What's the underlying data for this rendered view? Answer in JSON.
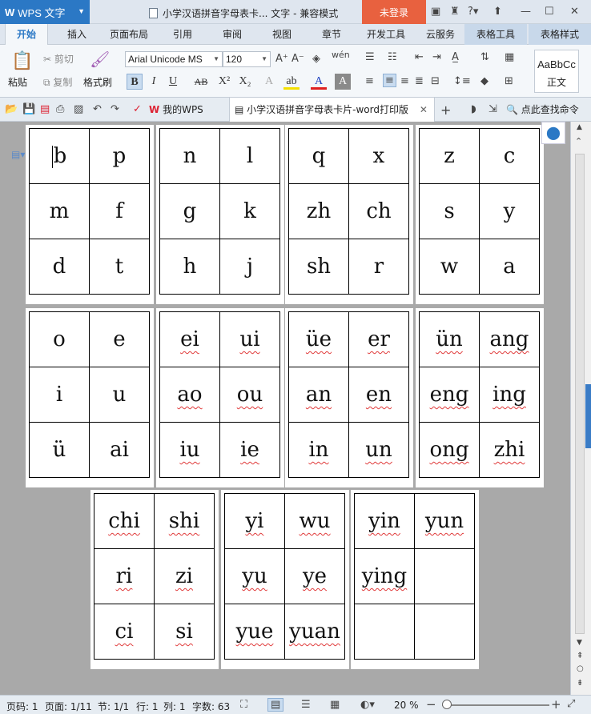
{
  "titlebar": {
    "app_name": "WPS 文字",
    "document_title": "小学汉语拼音字母表卡... 文字 - 兼容模式",
    "login_label": "未登录"
  },
  "ribbon_tabs": [
    "开始",
    "插入",
    "页面布局",
    "引用",
    "审阅",
    "视图",
    "章节",
    "开发工具",
    "云服务",
    "表格工具",
    "表格样式"
  ],
  "ribbon": {
    "paste_label": "粘贴",
    "cut_label": "剪切",
    "copy_label": "复制",
    "format_painter_label": "格式刷",
    "font_name": "Arial Unicode MS",
    "font_size": "120",
    "style_preview": "AaBbCc",
    "style_name": "正文"
  },
  "doc_tabs": {
    "my_wps": "我的WPS",
    "document": "小学汉语拼音字母表卡片-word打印版",
    "search_command": "点此查找命令"
  },
  "cards": [
    [
      [
        "b",
        "p"
      ],
      [
        "m",
        "f"
      ],
      [
        "d",
        "t"
      ]
    ],
    [
      [
        "n",
        "l"
      ],
      [
        "g",
        "k"
      ],
      [
        "h",
        "j"
      ]
    ],
    [
      [
        "q",
        "x"
      ],
      [
        "zh",
        "ch"
      ],
      [
        "sh",
        "r"
      ]
    ],
    [
      [
        "z",
        "c"
      ],
      [
        "s",
        "y"
      ],
      [
        "w",
        "a"
      ]
    ],
    [
      [
        "o",
        "e"
      ],
      [
        "i",
        "u"
      ],
      [
        "ü",
        "ai"
      ]
    ],
    [
      [
        "ei",
        "ui"
      ],
      [
        "ao",
        "ou"
      ],
      [
        "iu",
        "ie"
      ]
    ],
    [
      [
        "üe",
        "er"
      ],
      [
        "an",
        "en"
      ],
      [
        "in",
        "un"
      ]
    ],
    [
      [
        "ün",
        "ang"
      ],
      [
        "eng",
        "ing"
      ],
      [
        "ong",
        "zhi"
      ]
    ],
    [
      [
        "chi",
        "shi"
      ],
      [
        "ri",
        "zi"
      ],
      [
        "ci",
        "si"
      ]
    ],
    [
      [
        "yi",
        "wu"
      ],
      [
        "yu",
        "ye"
      ],
      [
        "yue",
        "yuan"
      ]
    ],
    [
      [
        "yin",
        "yun"
      ],
      [
        "ying",
        ""
      ],
      [
        "",
        ""
      ]
    ]
  ],
  "statusbar": {
    "page_code": "页码: 1",
    "page": "页面: 1/11",
    "section": "节: 1/1",
    "row": "行: 1",
    "column": "列: 1",
    "word_count": "字数: 63",
    "zoom": "20 %"
  },
  "colors": {
    "accent": "#2b78c5",
    "login": "#e8613f",
    "spellcheck": "#e03a3a"
  }
}
